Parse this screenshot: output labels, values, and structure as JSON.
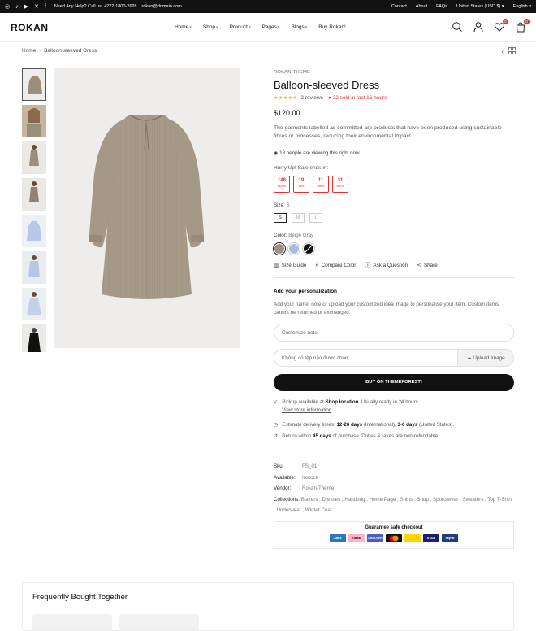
{
  "topbar": {
    "help_text": "Need Any Help? Call us: +222-1800-2628",
    "email": "rokan@domain.com",
    "contact": "Contact",
    "about": "About",
    "faqs": "FAQs",
    "currency": "United States (USD $)",
    "language": "English"
  },
  "header": {
    "logo": "ROKAN",
    "nav": [
      "Home",
      "Shop",
      "Product",
      "Pages",
      "Blogs",
      "Buy Rokan!"
    ],
    "wishlist_count": "0",
    "cart_count": "0"
  },
  "breadcrumb": {
    "home": "Home",
    "current": "Balloon-sleeved Dress"
  },
  "product": {
    "vendor": "ROKAN-THEME",
    "title": "Balloon-sleeved Dress",
    "reviews": "2 reviews",
    "sold": "22 sold in last 16 hours",
    "price": "$120.00",
    "description": "The garments labelled as committed are products that have been produced using sustainable fibres or processes, reducing their environmental impact.",
    "viewing": "18 people are viewing this right now",
    "hurry": "Hurry Up! Sale ends in:",
    "timer": [
      {
        "value": "148",
        "unit": "Days"
      },
      {
        "value": "19",
        "unit": "Hrs"
      },
      {
        "value": "11",
        "unit": "Mins"
      },
      {
        "value": "31",
        "unit": "Secs"
      }
    ],
    "size_label": "Size:",
    "size_selected": "S",
    "sizes": [
      "S",
      "M",
      "L"
    ],
    "color_label": "Color:",
    "color_selected": "Beige Gray",
    "colors": [
      "#9b9287",
      "#a9bde0",
      "#111111"
    ],
    "links": {
      "size_guide": "Size Guide",
      "compare": "Compare Color",
      "ask": "Ask a Question",
      "share": "Share"
    }
  },
  "personalization": {
    "title": "Add your personalization",
    "description": "Add your name, note or upload your customized idea image to personalise your item. Custom items cannot be returned or exchanged.",
    "note_placeholder": "Customize note",
    "file_text": "Không có tệp nào được chọn",
    "upload_label": "Upload Image"
  },
  "buy_button": "BUY ON THEMEFOREST!",
  "pickup": {
    "prefix": "Pickup available at ",
    "location": "Shop location.",
    "suffix": " Usually ready in 24 hours",
    "view_info": "View store information"
  },
  "delivery": {
    "prefix": "Estimate delivery times: ",
    "intl": "12-26 days",
    "intl_suffix": " (International), ",
    "us": "3-6 days",
    "us_suffix": " (United States)."
  },
  "returns": {
    "prefix": "Return within ",
    "days": "45 days",
    "suffix": " of purchase. Duties & taxes are non-refundable."
  },
  "meta": {
    "sku_label": "Sku:",
    "sku": "FS_01",
    "available_label": "Available:",
    "available": "Instock",
    "vendor_label": "Vendor:",
    "vendor": "Rokan-Theme",
    "collections_label": "Collections:",
    "collections": "Blazers , Dresses , Handbag , Home Page , Shirts , Shop , Sportswear , Sweaters , Top T-Shirt , Underwear , Winter Coat"
  },
  "checkout": {
    "title": "Guarantee safe checkout",
    "payments": [
      {
        "name": "AMEX",
        "color": "#2e77bc"
      },
      {
        "name": "Klarna.",
        "color": "#ffb3c7"
      },
      {
        "name": "DISCOVER",
        "color": "#4a5fc1"
      },
      {
        "name": "MC",
        "color": "#eb001b"
      },
      {
        "name": "VISA",
        "color": "#1a1f71"
      },
      {
        "name": "PayPal",
        "color": "#253b80"
      }
    ]
  },
  "fbt": {
    "title": "Frequently Bought Together"
  }
}
